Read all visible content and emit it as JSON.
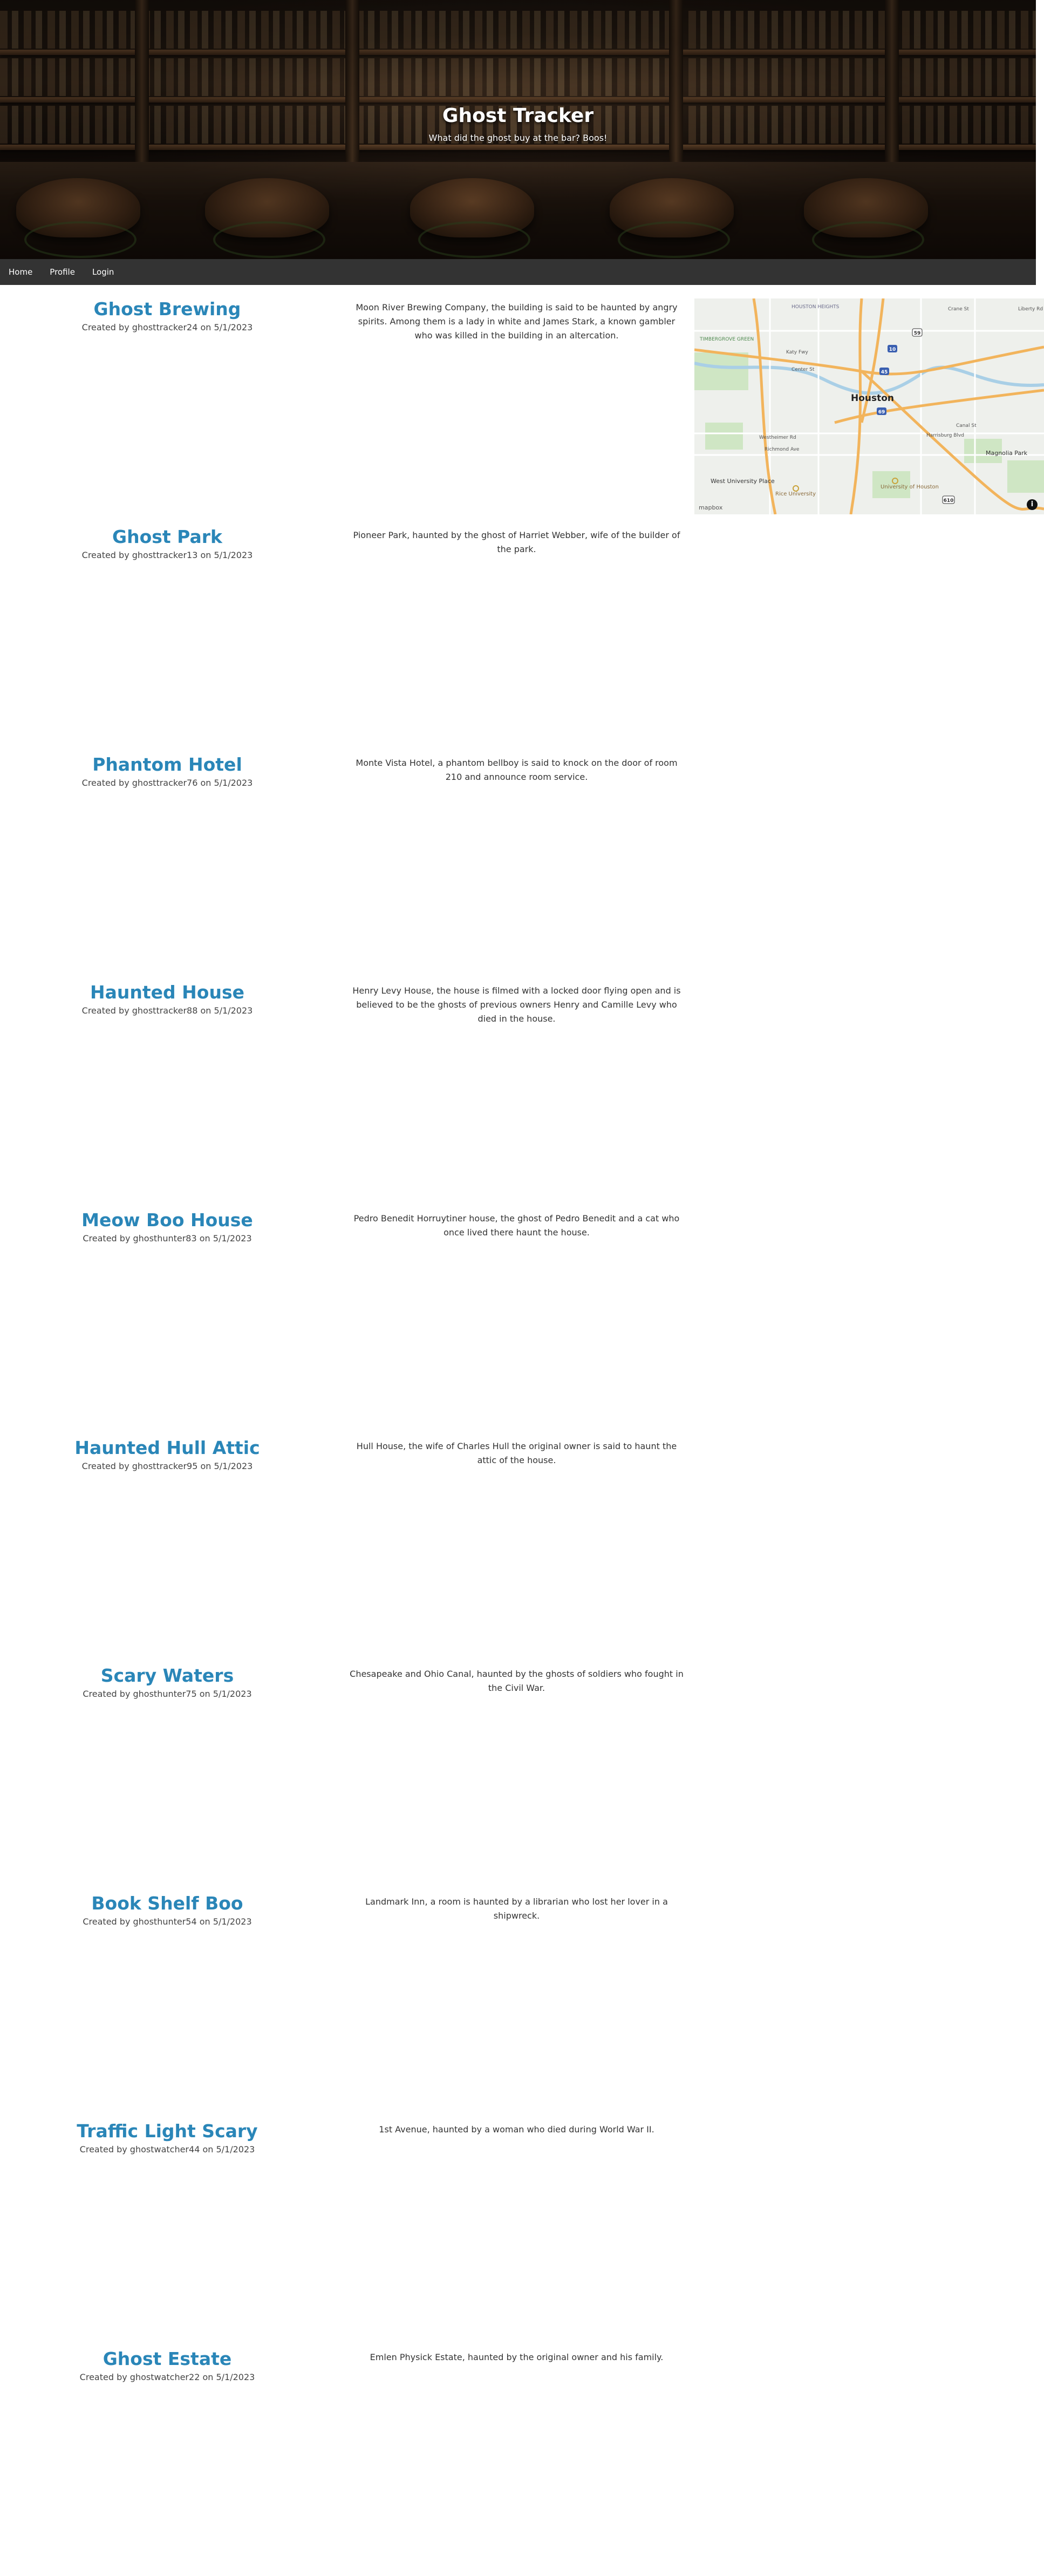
{
  "hero": {
    "title": "Ghost Tracker",
    "subtitle": "What did the ghost buy at the bar? Boos!"
  },
  "nav": {
    "items": [
      "Home",
      "Profile",
      "Login"
    ]
  },
  "map": {
    "labels": {
      "city": "Houston",
      "neighborhoods": [
        "HOUSTON HEIGHTS",
        "TIMBERGROVE GREEN",
        "West University Place",
        "Magnolia Park",
        "Rice University",
        "University of Houston"
      ],
      "streets": [
        "Katy Fwy",
        "Center St",
        "Richmond Ave",
        "Westheimer Rd",
        "Harrisburg Blvd",
        "Canal St",
        "Liberty Rd",
        "Crane St"
      ],
      "highway_shields": [
        "10",
        "45",
        "69",
        "59",
        "610"
      ]
    },
    "logo": "mapbox",
    "info_icon_label": "i"
  },
  "posts": [
    {
      "title": "Ghost Brewing",
      "meta": "Created by ghosttracker24 on 5/1/2023",
      "description": "Moon River Brewing Company, the building is said to be haunted by angry spirits. Among them is a lady in white and James Stark, a known gambler who was killed in the building in an altercation."
    },
    {
      "title": "Ghost Park",
      "meta": "Created by ghosttracker13 on 5/1/2023",
      "description": "Pioneer Park, haunted by the ghost of Harriet Webber, wife of the builder of the park."
    },
    {
      "title": "Phantom Hotel",
      "meta": "Created by ghosttracker76 on 5/1/2023",
      "description": "Monte Vista Hotel, a phantom bellboy is said to knock on the door of room 210 and announce room service."
    },
    {
      "title": "Haunted House",
      "meta": "Created by ghosttracker88 on 5/1/2023",
      "description": "Henry Levy House, the house is filmed with a locked door flying open and is believed to be the ghosts of previous owners Henry and Camille Levy who died in the house."
    },
    {
      "title": "Meow Boo House",
      "meta": "Created by ghosthunter83 on 5/1/2023",
      "description": "Pedro Benedit Horruytiner house, the ghost of Pedro Benedit and a cat who once lived there haunt the house."
    },
    {
      "title": "Haunted Hull Attic",
      "meta": "Created by ghosttracker95 on 5/1/2023",
      "description": "Hull House, the wife of Charles Hull the original owner is said to haunt the attic of the house."
    },
    {
      "title": "Scary Waters",
      "meta": "Created by ghosthunter75 on 5/1/2023",
      "description": "Chesapeake and Ohio Canal, haunted by the ghosts of soldiers who fought in the Civil War."
    },
    {
      "title": "Book Shelf Boo",
      "meta": "Created by ghosthunter54 on 5/1/2023",
      "description": "Landmark Inn, a room is haunted by a librarian who lost her lover in a shipwreck."
    },
    {
      "title": "Traffic Light Scary",
      "meta": "Created by ghostwatcher44 on 5/1/2023",
      "description": "1st Avenue, haunted by a woman who died during World War II."
    },
    {
      "title": "Ghost Estate",
      "meta": "Created by ghostwatcher22 on 5/1/2023",
      "description": "Emlen Physick Estate, haunted by the original owner and his family."
    }
  ]
}
